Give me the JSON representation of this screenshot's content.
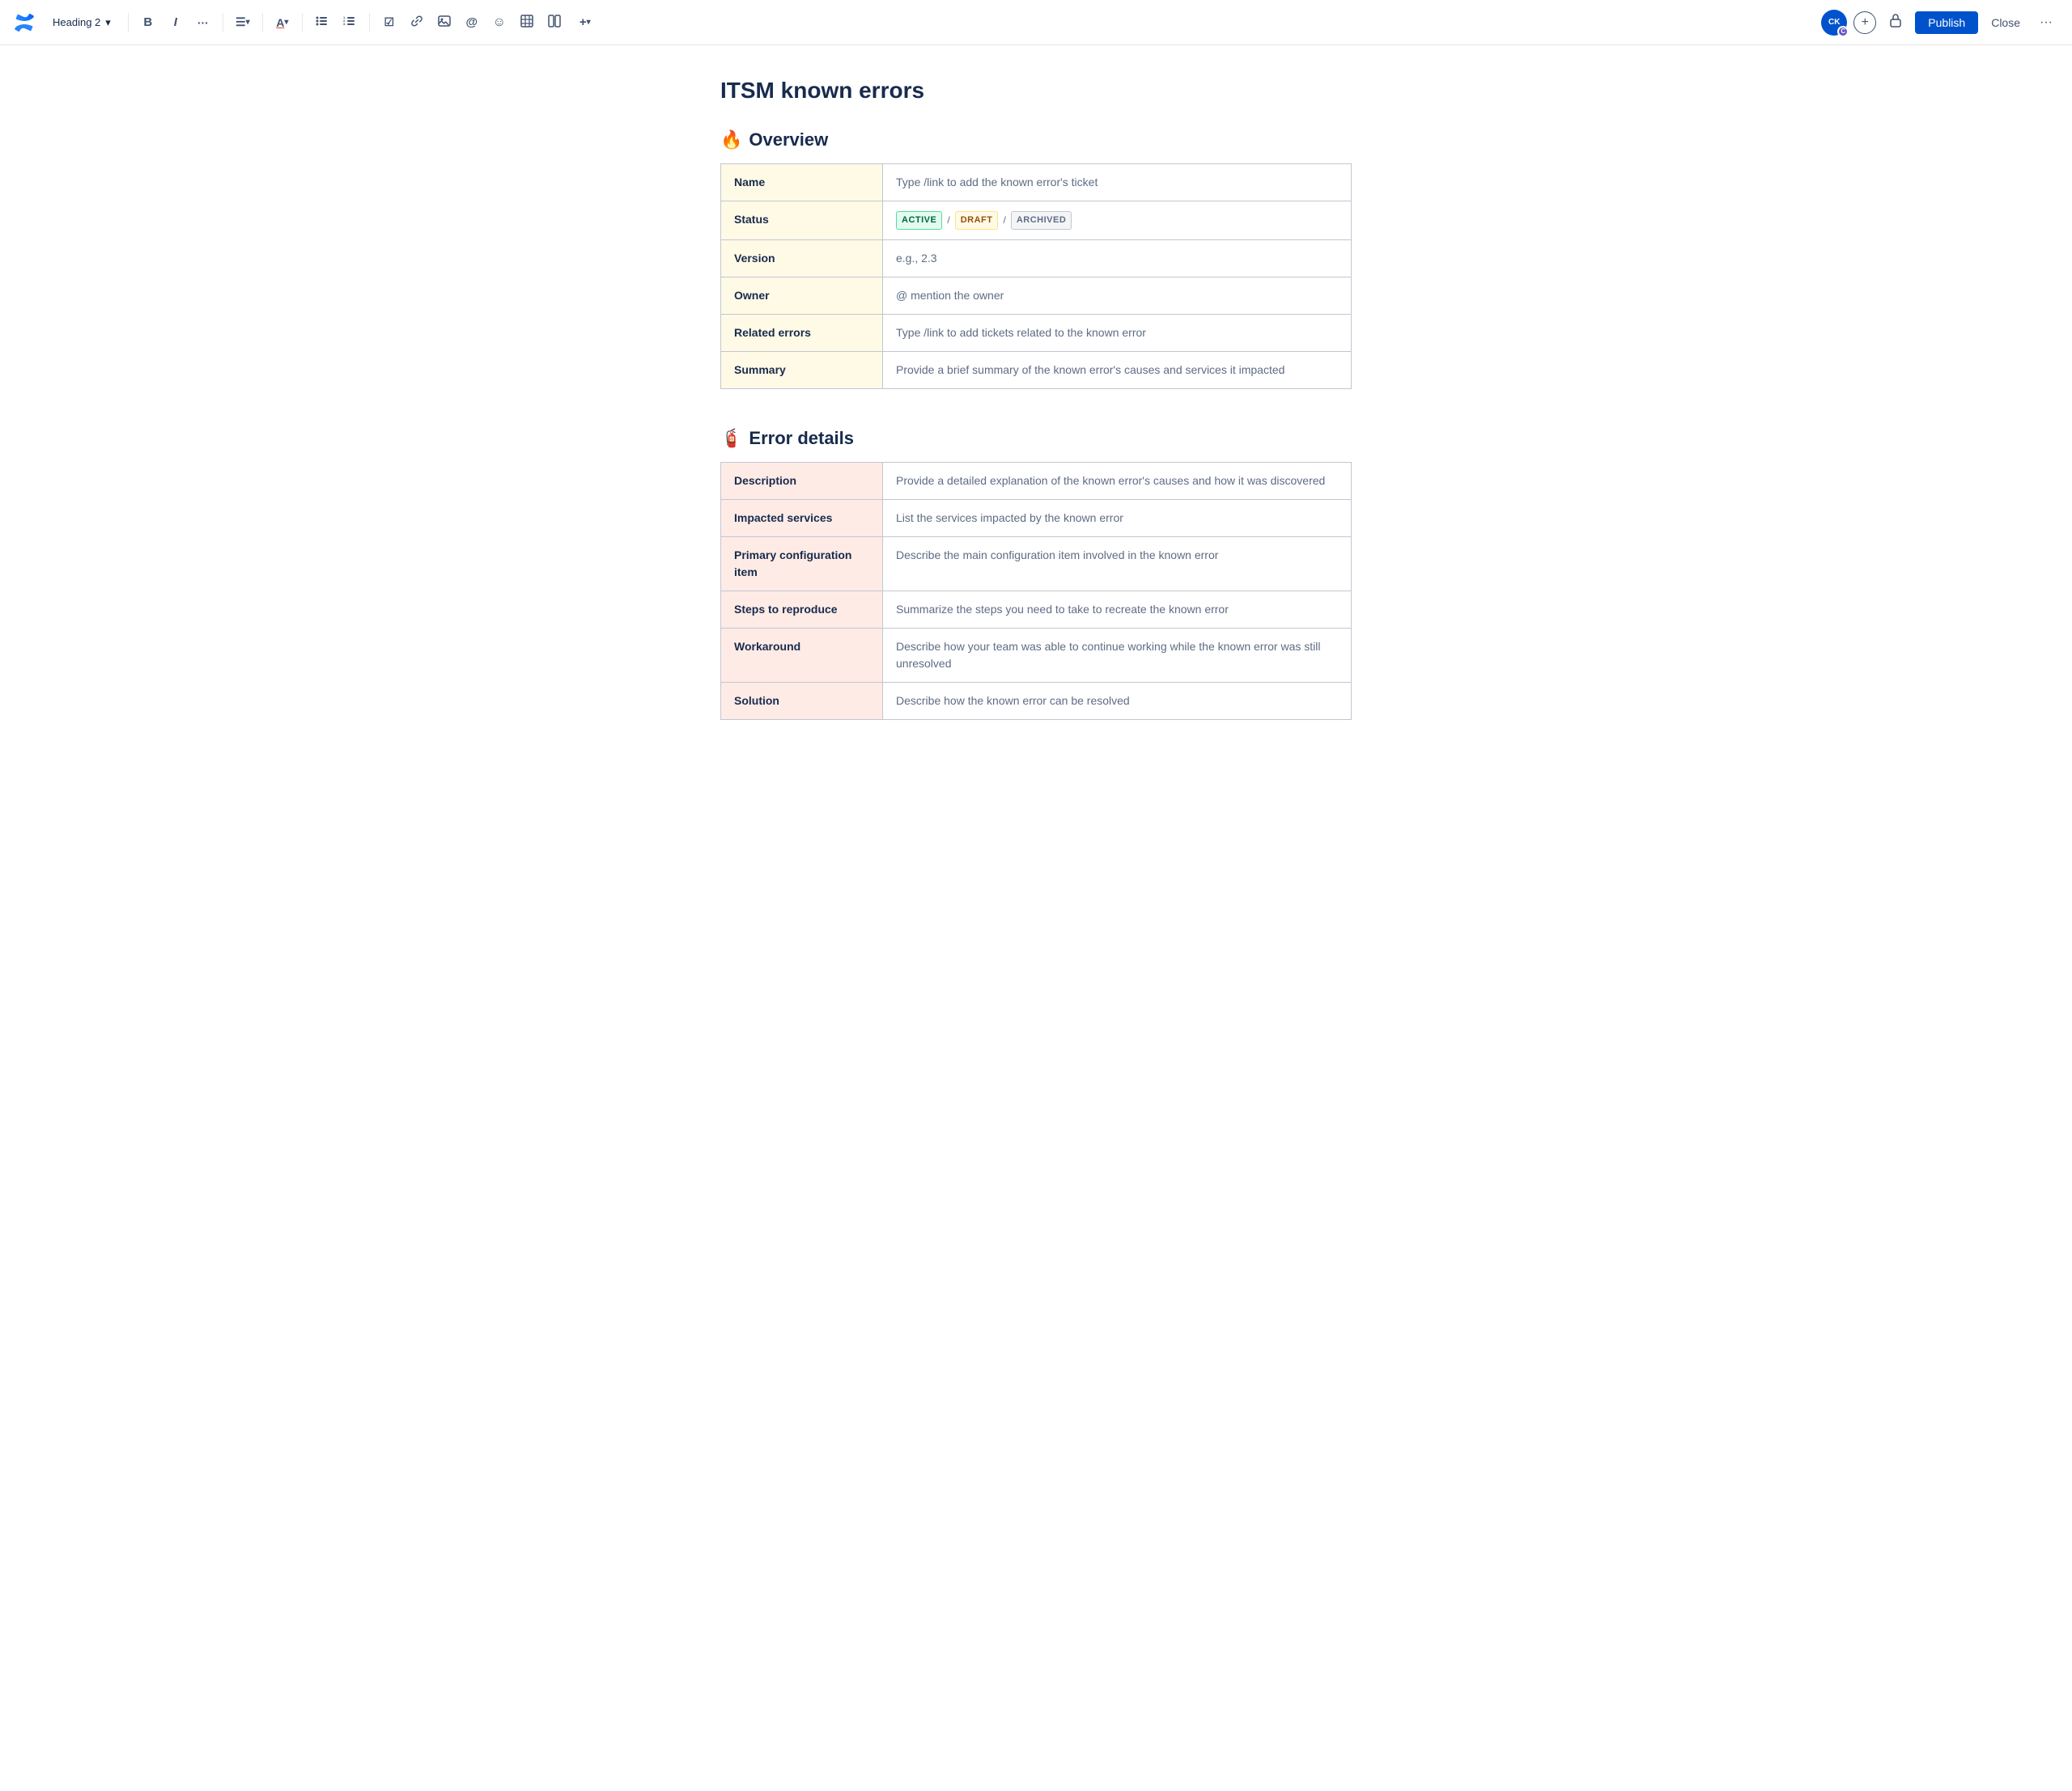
{
  "toolbar": {
    "logo_label": "Confluence",
    "heading_selector": "Heading 2",
    "chevron_icon": "▾",
    "bold_label": "B",
    "italic_label": "I",
    "more_label": "•••",
    "align_label": "≡",
    "align_chevron": "▾",
    "font_color_label": "A",
    "font_color_chevron": "▾",
    "bullet_list_label": "≡",
    "numbered_list_label": "≡",
    "task_icon": "☑",
    "link_icon": "🔗",
    "image_icon": "🖼",
    "mention_icon": "@",
    "emoji_icon": "☺",
    "table_icon": "⊞",
    "layout_icon": "⊟",
    "insert_icon": "+",
    "insert_chevron": "▾",
    "avatar_initials": "CK",
    "avatar_badge": "C",
    "add_icon": "+",
    "lock_icon": "🔒",
    "publish_label": "Publish",
    "close_label": "Close",
    "more_options_icon": "•••"
  },
  "page": {
    "title": "ITSM known errors",
    "overview_heading": "Overview",
    "overview_emoji": "🔥",
    "error_details_heading": "Error details",
    "error_details_emoji": "🧯"
  },
  "overview_table": {
    "rows": [
      {
        "label": "Name",
        "value": "Type /link to add the known error's ticket",
        "type": "text"
      },
      {
        "label": "Status",
        "value": "",
        "type": "badges"
      },
      {
        "label": "Version",
        "value": "e.g., 2.3",
        "type": "text"
      },
      {
        "label": "Owner",
        "value": "@ mention the owner",
        "type": "text"
      },
      {
        "label": "Related errors",
        "value": "Type /link to add tickets related to the known error",
        "type": "text"
      },
      {
        "label": "Summary",
        "value": "Provide a brief summary of the known error's causes and services it impacted",
        "type": "text"
      }
    ],
    "badges": [
      {
        "label": "ACTIVE",
        "type": "active"
      },
      {
        "sep": "/"
      },
      {
        "label": "DRAFT",
        "type": "draft"
      },
      {
        "sep": "/"
      },
      {
        "label": "ARCHIVED",
        "type": "archived"
      }
    ]
  },
  "error_table": {
    "rows": [
      {
        "label": "Description",
        "value": "Provide a detailed explanation of the known error's causes and how it was discovered"
      },
      {
        "label": "Impacted services",
        "value": "List the services impacted by the known error"
      },
      {
        "label": "Primary configuration item",
        "value": "Describe the main configuration item involved in the known error"
      },
      {
        "label": "Steps to reproduce",
        "value": "Summarize the steps you need to take to recreate the known error"
      },
      {
        "label": "Workaround",
        "value": "Describe how your team was able to continue working while the known error was still unresolved"
      },
      {
        "label": "Solution",
        "value": "Describe how the known error can be resolved"
      }
    ]
  }
}
